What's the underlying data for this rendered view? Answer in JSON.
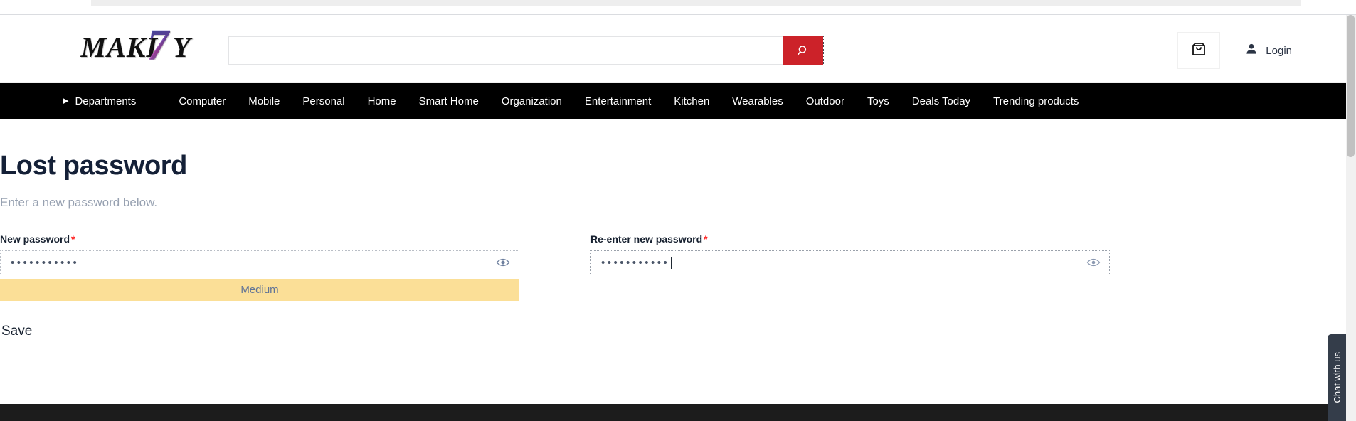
{
  "header": {
    "logo_main": "MAKI",
    "logo_accent": "7",
    "logo_tail": "Y",
    "logo_alt": "MAKI7Y",
    "search": {
      "value": "",
      "placeholder": "",
      "button_icon": "search-icon"
    },
    "cart_icon": "shopping-bag-icon",
    "account_icon": "user-icon",
    "account_label": "Login"
  },
  "nav": {
    "departments_label": "Departments",
    "departments_caret": "▶",
    "items": [
      {
        "label": "Computer"
      },
      {
        "label": "Mobile"
      },
      {
        "label": "Personal"
      },
      {
        "label": "Home"
      },
      {
        "label": "Smart Home"
      },
      {
        "label": "Organization"
      },
      {
        "label": "Entertainment"
      },
      {
        "label": "Kitchen"
      },
      {
        "label": "Wearables"
      },
      {
        "label": "Outdoor"
      },
      {
        "label": "Toys"
      },
      {
        "label": "Deals Today"
      },
      {
        "label": "Trending products"
      }
    ]
  },
  "page": {
    "title": "Lost password",
    "subtitle": "Enter a new password below."
  },
  "form": {
    "new_password": {
      "label": "New password",
      "required_mark": "*",
      "masked_value": "•••••••••••",
      "toggle_icon": "eye-icon"
    },
    "confirm_password": {
      "label": "Re-enter new password",
      "required_mark": "*",
      "masked_value": "•••••••••••",
      "toggle_icon": "eye-icon"
    },
    "strength": {
      "label": "Medium",
      "bar_color": "#fbdf97",
      "text_color": "#607396"
    },
    "save_label": "Save"
  },
  "chat_widget": {
    "label": "Chat with us"
  },
  "colors": {
    "accent_red": "#cc2229",
    "nav_black": "#000000",
    "title_navy": "#142037",
    "subtitle_gray": "#97a1b1",
    "required_red": "#ff2222",
    "footer_dark": "#1c1c1c",
    "chat_dark": "#343d4a"
  }
}
